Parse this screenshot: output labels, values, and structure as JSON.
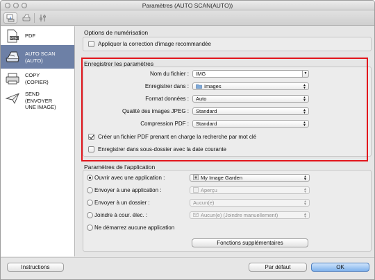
{
  "window": {
    "title": "Paramètres (AUTO SCAN(AUTO))"
  },
  "toolbar": {
    "icons": [
      "scan-from-computer-icon",
      "scan-from-panel-icon",
      "general-settings-icon"
    ]
  },
  "sidebar": {
    "items": [
      {
        "label": "PDF",
        "icon": "pdf-icon",
        "selected": false
      },
      {
        "label": "AUTO SCAN\n(AUTO)",
        "icon": "auto-scan-icon",
        "selected": true
      },
      {
        "label": "COPY\n(COPIER)",
        "icon": "copy-icon",
        "selected": false
      },
      {
        "label": "SEND\n(ENVOYER\nUNE IMAGE)",
        "icon": "send-icon",
        "selected": false
      }
    ]
  },
  "scan_options": {
    "title": "Options de numérisation",
    "apply_correction": {
      "label": "Appliquer la correction d'image recommandée",
      "checked": false
    }
  },
  "save_settings": {
    "title": "Enregistrer les paramètres",
    "file_name": {
      "label": "Nom du fichier :",
      "value": "IMG"
    },
    "save_in": {
      "label": "Enregistrer dans :",
      "value": "Images"
    },
    "data_format": {
      "label": "Format données :",
      "value": "Auto"
    },
    "jpeg_quality": {
      "label": "Qualité des images JPEG :",
      "value": "Standard"
    },
    "pdf_compression": {
      "label": "Compression PDF :",
      "value": "Standard"
    },
    "searchable_pdf": {
      "label": "Créer un fichier PDF prenant en charge la recherche par mot clé",
      "checked": true
    },
    "subfolder_date": {
      "label": "Enregistrer dans sous-dossier avec la date courante",
      "checked": false
    }
  },
  "app_settings": {
    "title": "Paramètres de l'application",
    "open_with": {
      "label": "Ouvrir avec une application :",
      "value": "My Image Garden",
      "selected": true
    },
    "send_to_app": {
      "label": "Envoyer à une application :",
      "value": "Aperçu",
      "selected": false
    },
    "send_to_folder": {
      "label": "Envoyer à un dossier :",
      "value": "Aucun(e)",
      "selected": false
    },
    "attach_email": {
      "label": "Joindre à cour. élec. :",
      "value": "Aucun(e) (Joindre manuellement)",
      "selected": false
    },
    "no_app": {
      "label": "Ne démarrez aucune application",
      "selected": false
    },
    "more_functions": "Fonctions supplémentaires"
  },
  "footer": {
    "instructions": "Instructions",
    "defaults": "Par défaut",
    "ok": "OK"
  },
  "colors": {
    "highlight": "#e2151b",
    "selection": "#6d80a6",
    "ok_button": "#7fb2ec"
  }
}
